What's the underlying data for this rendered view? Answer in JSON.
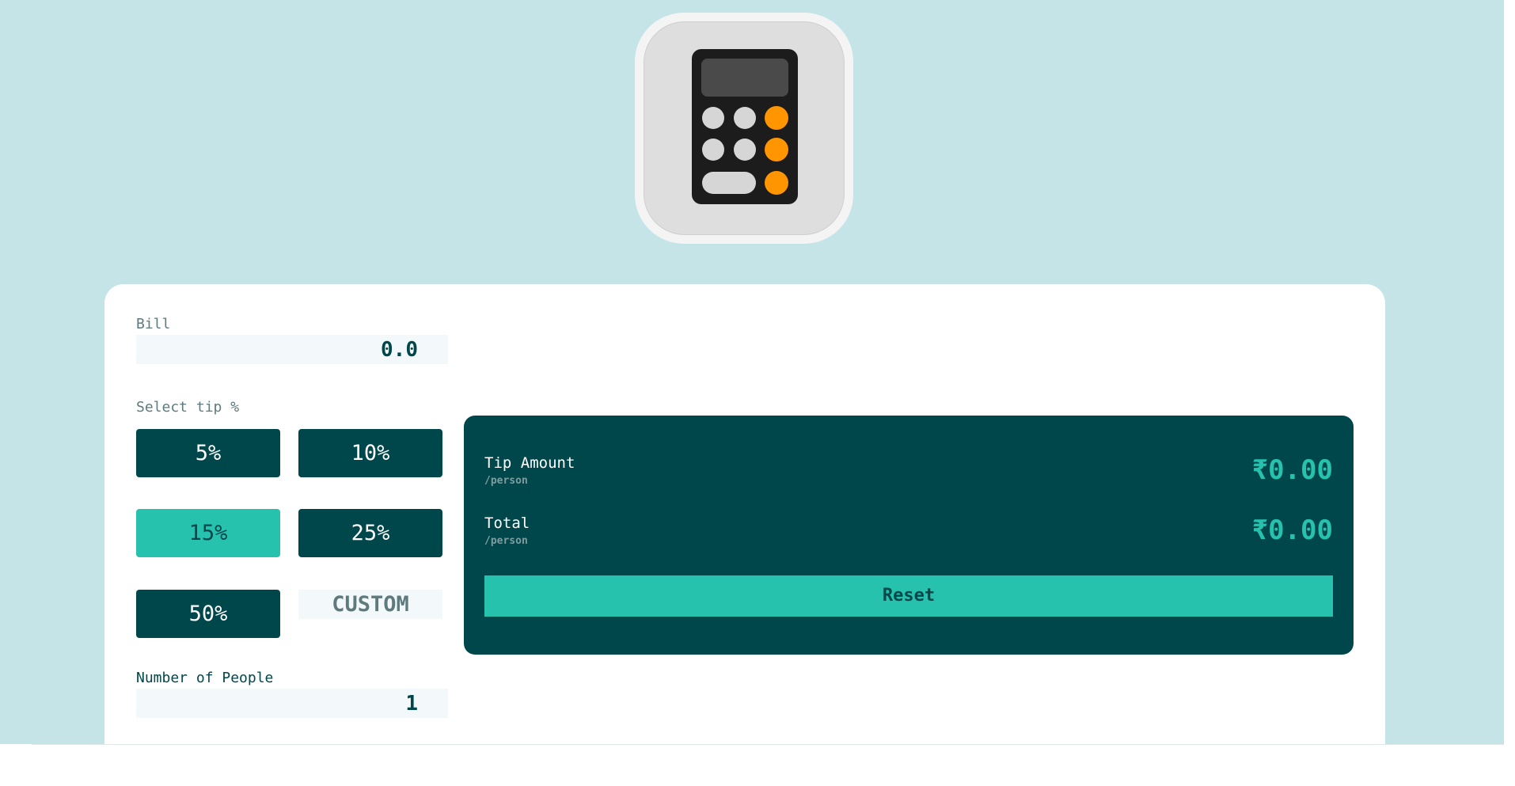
{
  "app_icon": {
    "icon": "calculator-icon"
  },
  "bill": {
    "label": "Bill",
    "value": "0.0"
  },
  "tip": {
    "label": "Select tip %",
    "options": [
      "5%",
      "10%",
      "15%",
      "25%",
      "50%"
    ],
    "selected": "15%",
    "custom_placeholder": "CUSTOM"
  },
  "people": {
    "label": "Number of People",
    "value": "1"
  },
  "results": {
    "tip_amount": {
      "title": "Tip Amount",
      "sub": "/person",
      "value": "₹0.00"
    },
    "total": {
      "title": "Total",
      "sub": "/person",
      "value": "₹0.00"
    },
    "reset_label": "Reset"
  },
  "colors": {
    "background": "#c5e4e7",
    "dark_cyan": "#00474b",
    "strong_cyan": "#26c2ae",
    "orange_key": "#ff9500"
  }
}
